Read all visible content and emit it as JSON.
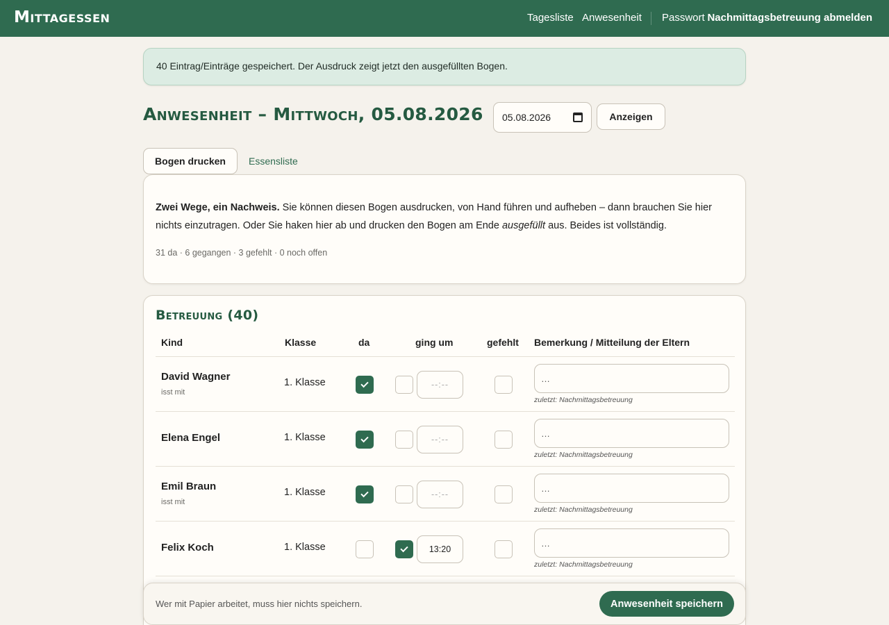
{
  "app": {
    "brand": "Mittagessen"
  },
  "nav": {
    "tagesliste": "Tagesliste",
    "anwesenheit": "Anwesenheit",
    "passwort": "Passwort",
    "abmelden": "Nachmittagsbetreuung abmelden"
  },
  "flash": "40 Eintrag/Einträge gespeichert. Der Ausdruck zeigt jetzt den ausgefüllten Bogen.",
  "page": {
    "title": "Anwesenheit – Mittwoch, 05.08.2026",
    "date_value": "05.08.2026",
    "show_button": "Anzeigen"
  },
  "tabs": {
    "print": "Bogen drucken",
    "meal_list": "Essensliste"
  },
  "info": {
    "lead": "Zwei Wege, ein Nachweis.",
    "text1": " Sie können diesen Bogen ausdrucken, von Hand führen und aufheben – dann brauchen Sie hier nichts einzutragen. Oder Sie haken hier ab und drucken den Bogen am Ende ",
    "emph": "ausgefüllt",
    "text2": " aus. Beides ist vollständig.",
    "stats": "31 da · 6 gegangen · 3 gefehlt · 0 noch offen"
  },
  "section": {
    "title": "Betreuung (40)",
    "headers": {
      "kind": "Kind",
      "klasse": "Klasse",
      "da": "da",
      "ging_um": "ging um",
      "gefehlt": "gefehlt",
      "bemerkung": "Bemerkung / Mitteilung der Eltern"
    }
  },
  "rows": [
    {
      "name": "David Wagner",
      "note": "isst mit",
      "klasse": "1. Klasse",
      "da": true,
      "gone": false,
      "time": "--:--",
      "missed": false,
      "remark_placeholder": "…",
      "last_by": "zuletzt: Nachmittagsbetreuung"
    },
    {
      "name": "Elena Engel",
      "note": "",
      "klasse": "1. Klasse",
      "da": true,
      "gone": false,
      "time": "--:--",
      "missed": false,
      "remark_placeholder": "…",
      "last_by": "zuletzt: Nachmittagsbetreuung"
    },
    {
      "name": "Emil Braun",
      "note": "isst mit",
      "klasse": "1. Klasse",
      "da": true,
      "gone": false,
      "time": "--:--",
      "missed": false,
      "remark_placeholder": "…",
      "last_by": "zuletzt: Nachmittagsbetreuung"
    },
    {
      "name": "Felix Koch",
      "note": "",
      "klasse": "1. Klasse",
      "da": false,
      "gone": true,
      "time": "13:20",
      "missed": false,
      "remark_placeholder": "…",
      "last_by": "zuletzt: Nachmittagsbetreuung"
    }
  ],
  "footer": {
    "text": "Wer mit Papier arbeitet, muss hier nichts speichern.",
    "save": "Anwesenheit speichern"
  }
}
